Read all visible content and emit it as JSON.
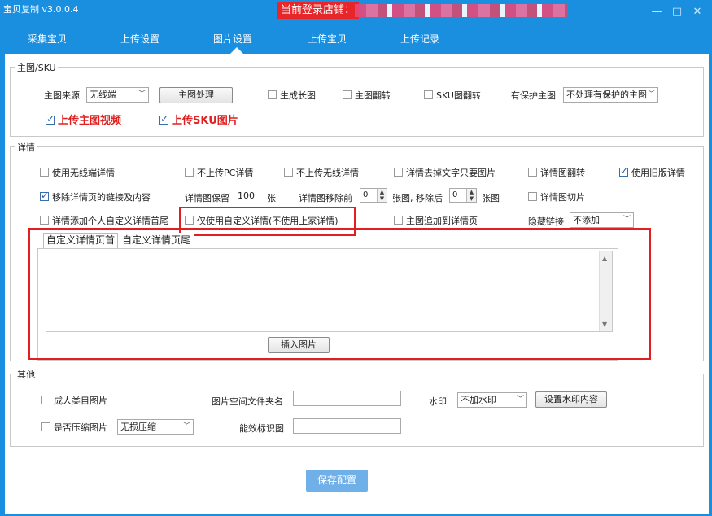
{
  "app": {
    "title": "宝贝复制 v3.0.0.4",
    "login_label": "当前登录店铺："
  },
  "tabs": [
    {
      "label": "采集宝贝"
    },
    {
      "label": "上传设置"
    },
    {
      "label": "图片设置"
    },
    {
      "label": "上传宝贝"
    },
    {
      "label": "上传记录"
    }
  ],
  "active_tab": "图片设置",
  "main_image": {
    "legend": "主图/SKU",
    "source_label": "主图来源",
    "source_value": "无线端",
    "process_button": "主图处理",
    "long_image": "生成长图",
    "flip_main": "主图翻转",
    "flip_sku": "SKU图翻转",
    "protected_label": "有保护主图",
    "protected_value": "不处理有保护的主图",
    "upload_video": "上传主图视频",
    "upload_sku": "上传SKU图片"
  },
  "details": {
    "legend": "详情",
    "use_mobile": "使用无线端详情",
    "no_pc": "不上传PC详情",
    "no_mobile": "不上传无线详情",
    "remove_text": "详情去掉文字只要图片",
    "flip_detail": "详情图翻转",
    "use_old": "使用旧版详情",
    "remove_links": "移除详情页的链接及内容",
    "keep_label": "详情图保留",
    "keep_value": "100",
    "keep_unit": "张",
    "remove_front_label": "详情图移除前",
    "remove_front_value": "0",
    "remove_after_label": "张图, 移除后",
    "remove_after_value": "0",
    "remove_after_unit": "张图",
    "slice": "详情图切片",
    "add_header": "详情添加个人自定义详情首尾",
    "only_custom": "仅使用自定义详情(不使用上家详情)",
    "append_main": "主图追加到详情页",
    "hidden_links_label": "隐藏链接",
    "hidden_links_value": "不添加",
    "tab_header": "自定义详情页首",
    "tab_footer": "自定义详情页尾",
    "insert_button": "插入图片"
  },
  "other": {
    "legend": "其他",
    "adult": "成人类目图片",
    "folder_label": "图片空间文件夹名",
    "watermark_label": "水印",
    "watermark_value": "不加水印",
    "watermark_button": "设置水印内容",
    "compress": "是否压缩图片",
    "compress_value": "无损压缩",
    "efficacy_label": "能效标识图"
  },
  "save_button": "保存配置"
}
